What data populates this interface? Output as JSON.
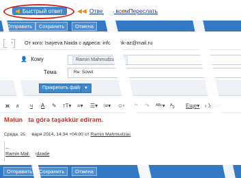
{
  "reply_modes": {
    "quick_reply": "Быстрый ответ",
    "reply_all": "Ответить всем",
    "forward": "Переслать"
  },
  "top_actions": {
    "send": "Отправить",
    "save": "Сохранить",
    "cancel": "Отмена"
  },
  "from": {
    "text": "От кого: Isayeva Naida  с адреса: informatik-az@mail.ru"
  },
  "to": {
    "label": "Кому",
    "recipient": "Ramin Mahmudzade ×"
  },
  "subject": {
    "label": "Тема",
    "value": "Re: Sovet"
  },
  "attach": {
    "button": "Прикрепить файл",
    "dropdown": "▼"
  },
  "format": {
    "bold": "ж",
    "italic": "к",
    "underline": "ч",
    "font_color": "A",
    "more": "Еще",
    "remove_format": "‹ Убра"
  },
  "body": {
    "thanks": "Məlumata görə təşəkkür edirəm.",
    "quote_prefix": "Среда, 29 января 2014, 14:34 +04:00 от ",
    "quote_author": "Ramin Mahmudzade",
    "separator": "--",
    "signature": "Ramin Mahmudzade"
  },
  "bottom_actions": {
    "send": "Отправить",
    "save": "Сохранить",
    "cancel": "Отмена"
  },
  "colors": {
    "toolbar_blue": "#3478c4",
    "highlight_red": "#d31d1d",
    "thanks_red": "#d42a1c"
  }
}
